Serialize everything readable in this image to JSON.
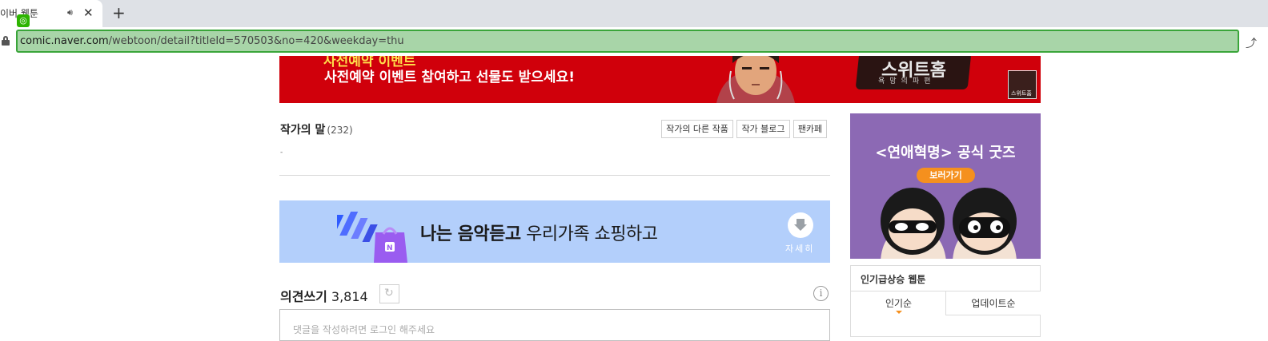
{
  "browser": {
    "tab_title": "이버 웹툰",
    "url_host": "comic.naver.com",
    "url_path": "/webtoon/detail?titleId=570503&no=420&weekday=thu"
  },
  "banner": {
    "line1": "사전예약 이벤트",
    "line2": "사전예약 이벤트 참여하고 선물도 받으세요!",
    "logo_text": "스위트홈",
    "logo_sub": "욕망의파편",
    "thumb_text": "스위트홈"
  },
  "author": {
    "heading": "작가의 말",
    "count": "(232)",
    "body": "-",
    "buttons": [
      "작가의 다른 작품",
      "작가 블로그",
      "팬카페"
    ]
  },
  "ad": {
    "text_bold": "나는 음악듣고",
    "text_normal": " 우리가족 쇼핑하고",
    "detail_label": "자세히"
  },
  "comments": {
    "heading": "의견쓰기",
    "count": "3,814",
    "placeholder": "댓글을 작성하려면 로그인 해주세요"
  },
  "side_ad": {
    "title": "<연애혁명> 공식 굿즈",
    "button_label": "보러가기"
  },
  "ranking": {
    "title": "인기급상승 웹툰",
    "tabs": [
      "인기순",
      "업데이트순"
    ]
  },
  "colors": {
    "banner_red": "#d0000b",
    "ad_blue": "#b3cffb",
    "side_purple": "#8c69b4",
    "accent_orange": "#f5901e",
    "url_highlight": "#a8d5a8"
  }
}
